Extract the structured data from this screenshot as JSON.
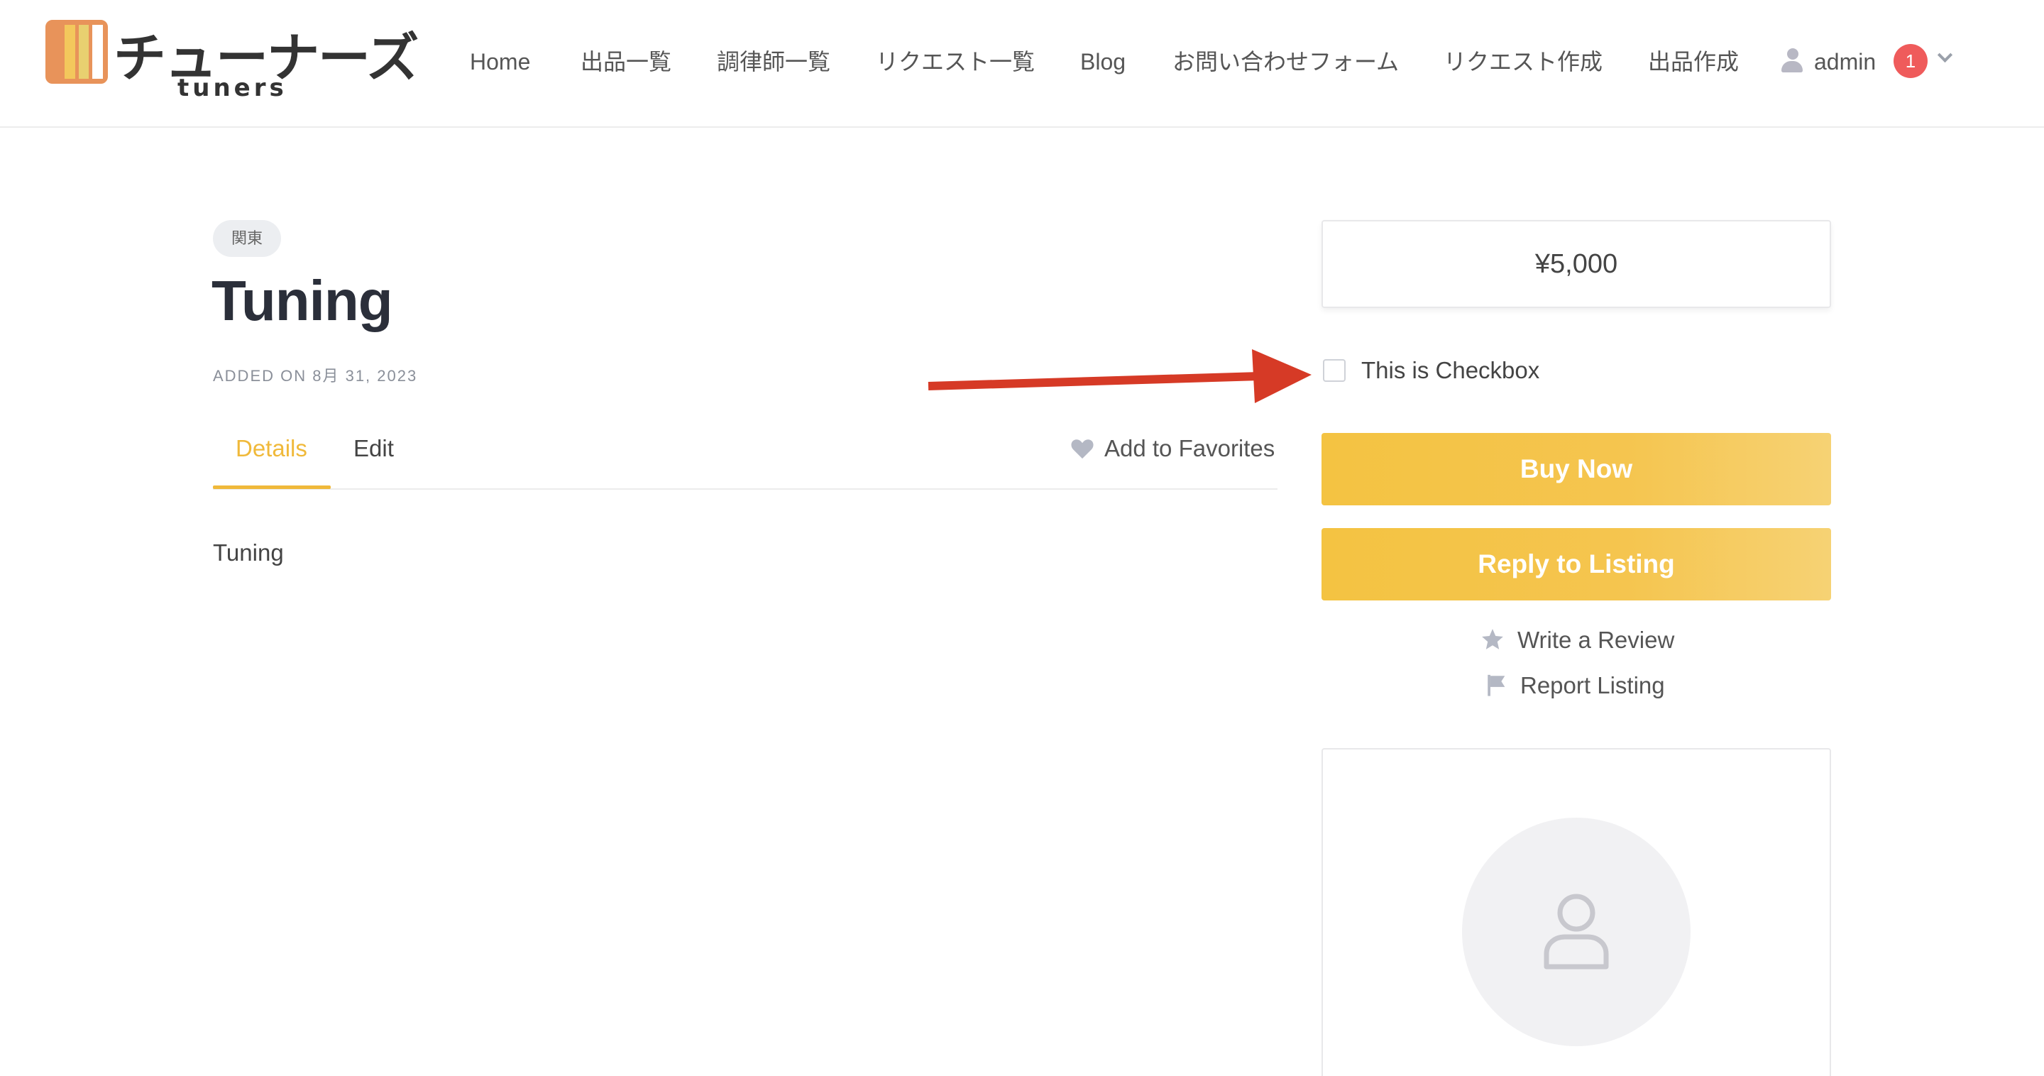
{
  "brand": {
    "logo_jp": "チューナーズ",
    "logo_en": "tuners"
  },
  "nav": {
    "items": [
      {
        "label": "Home"
      },
      {
        "label": "出品一覧"
      },
      {
        "label": "調律師一覧"
      },
      {
        "label": "リクエスト一覧"
      },
      {
        "label": "Blog"
      },
      {
        "label": "お問い合わせフォーム"
      },
      {
        "label": "リクエスト作成"
      },
      {
        "label": "出品作成"
      }
    ],
    "user": {
      "name": "admin",
      "notification_count": "1",
      "icon": "user-icon"
    }
  },
  "listing": {
    "region": "関東",
    "title": "Tuning",
    "added_on": "ADDED ON 8月 31, 2023",
    "tabs": [
      {
        "label": "Details",
        "active": true
      },
      {
        "label": "Edit",
        "active": false
      }
    ],
    "favorite_label": "Add to Favorites",
    "description": "Tuning"
  },
  "sidebar": {
    "price": "¥5,000",
    "checkbox": {
      "label": "This is Checkbox",
      "checked": false
    },
    "buy_label": "Buy Now",
    "reply_label": "Reply to Listing",
    "review_label": "Write a Review",
    "report_label": "Report Listing"
  },
  "colors": {
    "accent": "#f0b93a",
    "button": "#f4c342",
    "badge": "#ef5b5b",
    "arrow": "#d63a26"
  }
}
